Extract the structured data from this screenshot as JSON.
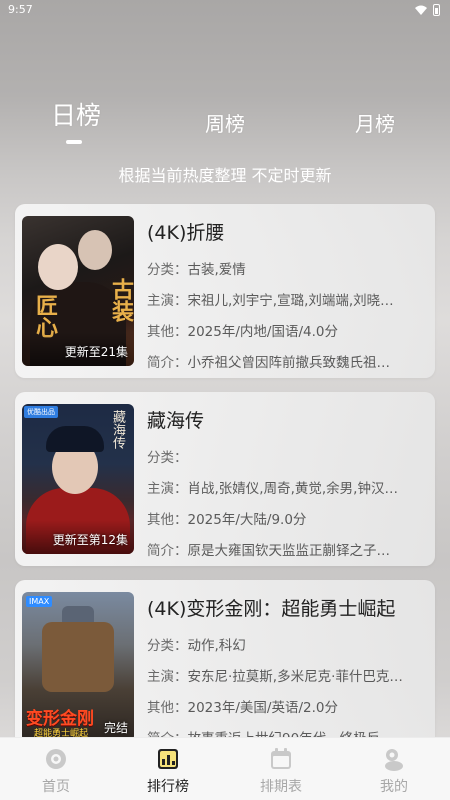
{
  "status_bar": {
    "time": "9:57"
  },
  "tabs": [
    {
      "label": "日榜",
      "active": true
    },
    {
      "label": "周榜",
      "active": false
    },
    {
      "label": "月榜",
      "active": false
    }
  ],
  "subtitle": "根据当前热度整理 不定时更新",
  "items": [
    {
      "title": "(4K)折腰",
      "poster_title": "古装",
      "poster_title_b": "匠心",
      "poster_label": "更新至21集",
      "category_key": "分类：",
      "category": "古装,爱情",
      "cast_key": "主演：",
      "cast": "宋祖儿,刘宇宁,宣璐,刘端端,刘晓…",
      "other_key": "其他：",
      "other": "2025年/内地/国语/4.0分",
      "intro_key": "简介：",
      "intro": "小乔祖父曾因阵前撤兵致魏氏祖…"
    },
    {
      "title": "藏海传",
      "poster_title": "藏海传",
      "poster_badge": "优酷出品",
      "poster_label": "更新至第12集",
      "category_key": "分类：",
      "category": "",
      "cast_key": "主演：",
      "cast": "肖战,张婧仪,周奇,黄觉,余男,钟汉…",
      "other_key": "其他：",
      "other": "2025年/大陆/9.0分",
      "intro_key": "简介：",
      "intro": "原是大雍国钦天监监正蒯铎之子…"
    },
    {
      "title": "(4K)变形金刚：超能勇士崛起",
      "poster_title": "变形金刚",
      "poster_sub": "超能勇士崛起",
      "poster_badge": "IMAX",
      "poster_label": "完结",
      "category_key": "分类：",
      "category": "动作,科幻",
      "cast_key": "主演：",
      "cast": "安东尼·拉莫斯,多米尼克·菲什巴克…",
      "other_key": "其他：",
      "other": "2023年/美国/英语/2.0分",
      "intro_key": "简介：",
      "intro": "故事重返上世纪90年代，终极反…"
    }
  ],
  "bottom_nav": [
    {
      "label": "首页",
      "icon": "home-icon",
      "active": false
    },
    {
      "label": "排行榜",
      "icon": "ranking-icon",
      "active": true
    },
    {
      "label": "排期表",
      "icon": "calendar-icon",
      "active": false
    },
    {
      "label": "我的",
      "icon": "profile-icon",
      "active": false
    }
  ],
  "colors": {
    "nav_active": "#222222",
    "nav_inactive": "#a8a8a8",
    "accent_red": "#ff4b22"
  }
}
